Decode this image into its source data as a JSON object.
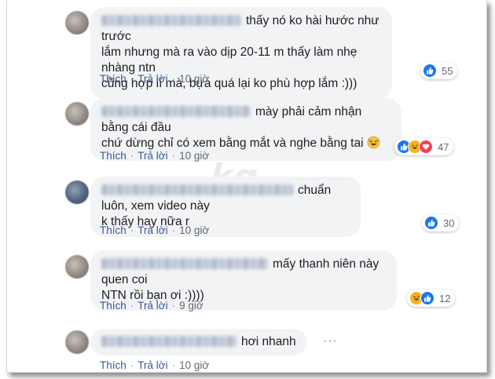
{
  "comments": [
    {
      "text_lines": [
        "thấy nó ko hài hước như trước",
        "lắm nhưng mà ra vào dịp 20-11 m thấy làm nhẹ nhàng ntn",
        "cũng hợp lí mà, bựa quá lại ko phù hợp lắm :)))"
      ],
      "like_label": "Thích",
      "reply_label": "Trả lời",
      "time": "10 giờ",
      "reaction_icons": [
        "like-icon"
      ],
      "reaction_count": "55"
    },
    {
      "text_lines": [
        "mày phải cảm nhận bằng cái đầu",
        "chứ dừng chỉ có xem bằng mắt và nghe bằng tai"
      ],
      "like_label": "Thích",
      "reply_label": "Trả lời",
      "time": "10 giờ",
      "reaction_icons": [
        "like-icon",
        "haha-icon",
        "love-icon"
      ],
      "reaction_count": "47"
    },
    {
      "text_lines": [
        "chuẩn luôn, xem video này",
        "k thấy hay nữa r"
      ],
      "like_label": "Thích",
      "reply_label": "Trả lời",
      "time": "10 giờ",
      "reaction_icons": [
        "like-icon"
      ],
      "reaction_count": "30"
    },
    {
      "text_lines": [
        "mấy thanh niên này quen coi",
        "NTN rồi bạn ơi :))))"
      ],
      "like_label": "Thích",
      "reply_label": "Trả lời",
      "time": "9 giờ",
      "reaction_icons": [
        "haha-icon",
        "like-icon"
      ],
      "reaction_count": "12"
    },
    {
      "text_lines": [
        "hơi nhanh"
      ],
      "like_label": "Thích",
      "reply_label": "Trả lời",
      "time": "10 giờ",
      "reaction_icons": [],
      "reaction_count": ""
    }
  ],
  "separator": "·",
  "colors": {
    "bubble_bg": "#f2f3f5",
    "action_link": "#385898",
    "like_blue": "#1877f2",
    "haha_yellow": "#f7b125",
    "love_red": "#f33e58"
  }
}
